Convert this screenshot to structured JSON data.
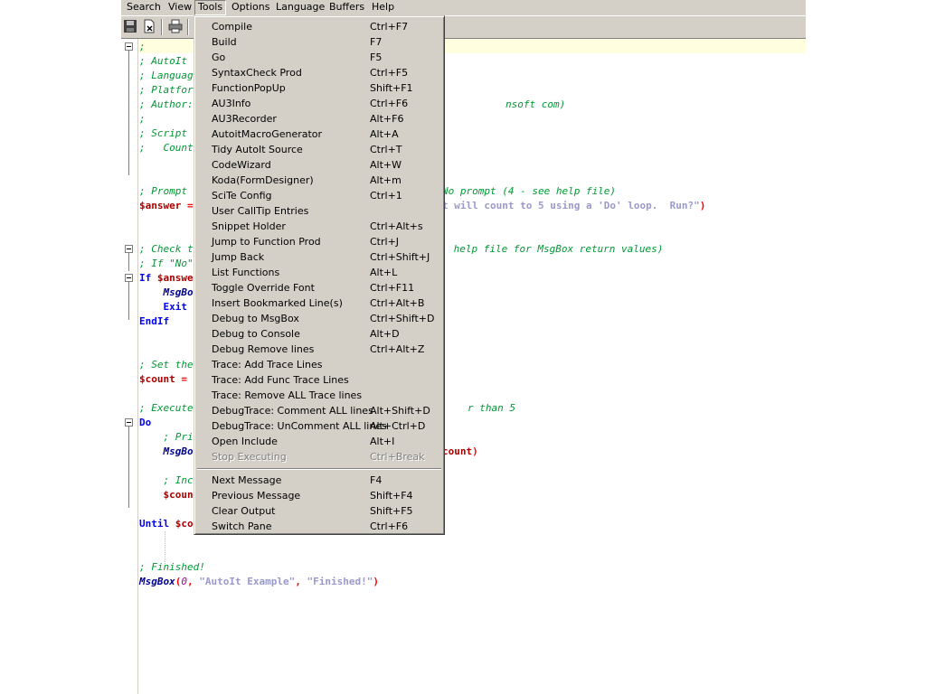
{
  "menubar": {
    "items": [
      "Search",
      "View",
      "Tools",
      "Options",
      "Language",
      "Buffers",
      "Help"
    ],
    "active": "Tools"
  },
  "toolbar": {
    "icons": [
      "save-icon",
      "close-file-icon",
      "print-icon"
    ]
  },
  "code_lines": [
    {
      "row": 0,
      "parts": [
        {
          "c": "cmt",
          "t": ";"
        }
      ]
    },
    {
      "row": 1,
      "parts": [
        {
          "c": "cmt",
          "t": "; AutoIt "
        }
      ]
    },
    {
      "row": 2,
      "parts": [
        {
          "c": "cmt",
          "t": "; Languag"
        }
      ]
    },
    {
      "row": 3,
      "parts": [
        {
          "c": "cmt",
          "t": "; Platfor"
        }
      ]
    },
    {
      "row": 4,
      "parts": [
        {
          "c": "cmt",
          "t": "; Author:"
        }
      ]
    },
    {
      "row": 5,
      "parts": [
        {
          "c": "cmt",
          "t": ";"
        }
      ]
    },
    {
      "row": 6,
      "parts": [
        {
          "c": "cmt",
          "t": "; Script "
        }
      ]
    },
    {
      "row": 7,
      "parts": [
        {
          "c": "cmt",
          "t": ";   Count"
        }
      ]
    },
    {
      "row": 10,
      "parts": [
        {
          "c": "cmt",
          "t": "; Prompt "
        }
      ]
    },
    {
      "row": 11,
      "parts": [
        {
          "c": "var",
          "t": "$answer"
        },
        {
          "c": "op",
          "t": " ="
        }
      ]
    },
    {
      "row": 14,
      "parts": [
        {
          "c": "cmt",
          "t": "; Check t"
        }
      ]
    },
    {
      "row": 15,
      "parts": [
        {
          "c": "cmt",
          "t": "; If \"No\""
        }
      ]
    },
    {
      "row": 16,
      "parts": [
        {
          "c": "kw",
          "t": "If "
        },
        {
          "c": "var",
          "t": "$answe"
        }
      ]
    },
    {
      "row": 17,
      "parts": [
        {
          "c": "",
          "t": "    "
        },
        {
          "c": "fn",
          "t": "MsgBo"
        }
      ]
    },
    {
      "row": 18,
      "parts": [
        {
          "c": "",
          "t": "    "
        },
        {
          "c": "kw",
          "t": "Exit"
        }
      ]
    },
    {
      "row": 19,
      "parts": [
        {
          "c": "kw",
          "t": "EndIf"
        }
      ]
    },
    {
      "row": 22,
      "parts": [
        {
          "c": "cmt",
          "t": "; Set the"
        }
      ]
    },
    {
      "row": 23,
      "parts": [
        {
          "c": "var",
          "t": "$count"
        },
        {
          "c": "op",
          "t": " ="
        }
      ]
    },
    {
      "row": 25,
      "parts": [
        {
          "c": "cmt",
          "t": "; Execute"
        }
      ]
    },
    {
      "row": 26,
      "parts": [
        {
          "c": "kw",
          "t": "Do"
        }
      ]
    },
    {
      "row": 27,
      "parts": [
        {
          "c": "",
          "t": "    "
        },
        {
          "c": "cmt",
          "t": "; Pri"
        }
      ]
    },
    {
      "row": 28,
      "parts": [
        {
          "c": "",
          "t": "    "
        },
        {
          "c": "fn",
          "t": "MsgBo"
        }
      ]
    },
    {
      "row": 30,
      "parts": [
        {
          "c": "",
          "t": "    "
        },
        {
          "c": "cmt",
          "t": "; Inc"
        }
      ]
    },
    {
      "row": 31,
      "parts": [
        {
          "c": "",
          "t": "    "
        },
        {
          "c": "var",
          "t": "$coun"
        }
      ]
    },
    {
      "row": 33,
      "parts": [
        {
          "c": "kw",
          "t": "Until "
        },
        {
          "c": "var",
          "t": "$co"
        }
      ]
    },
    {
      "row": 36,
      "parts": [
        {
          "c": "cmt",
          "t": "; Finished!"
        }
      ]
    },
    {
      "row": 37,
      "parts": [
        {
          "c": "fn",
          "t": "MsgBox"
        },
        {
          "c": "op",
          "t": "("
        },
        {
          "c": "num",
          "t": "0"
        },
        {
          "c": "op",
          "t": ", "
        },
        {
          "c": "str",
          "t": "\"AutoIt Example\""
        },
        {
          "c": "op",
          "t": ", "
        },
        {
          "c": "str",
          "t": "\"Finished!\""
        },
        {
          "c": "op",
          "t": ")"
        }
      ]
    }
  ],
  "code_right_fragments": [
    {
      "row": 4,
      "parts": [
        {
          "c": "cmt",
          "t": "nsoft com)"
        }
      ]
    },
    {
      "row": 10,
      "parts": [
        {
          "c": "cmt",
          "t": "No prompt (4 - see help file)"
        }
      ]
    },
    {
      "row": 11,
      "parts": [
        {
          "c": "str",
          "t": "t will count to 5 using a 'Do' loop.  Run?\""
        },
        {
          "c": "op",
          "t": ")"
        }
      ]
    },
    {
      "row": 14,
      "parts": [
        {
          "c": "cmt",
          "t": " help file for MsgBox return values)"
        }
      ]
    },
    {
      "row": 25,
      "parts": [
        {
          "c": "cmt",
          "t": "r than 5"
        }
      ]
    },
    {
      "row": 28,
      "parts": [
        {
          "c": "var",
          "t": "count"
        },
        {
          "c": "op",
          "t": ")"
        }
      ]
    }
  ],
  "tools_menu": {
    "group1": [
      {
        "label": "Compile",
        "shortcut": "Ctrl+F7"
      },
      {
        "label": "Build",
        "shortcut": "F7"
      },
      {
        "label": "Go",
        "shortcut": "F5"
      },
      {
        "label": "SyntaxCheck Prod",
        "shortcut": "Ctrl+F5"
      },
      {
        "label": "FunctionPopUp",
        "shortcut": "Shift+F1"
      },
      {
        "label": "AU3Info",
        "shortcut": "Ctrl+F6"
      },
      {
        "label": "AU3Recorder",
        "shortcut": "Alt+F6"
      },
      {
        "label": "AutoitMacroGenerator",
        "shortcut": "Alt+A"
      },
      {
        "label": "Tidy AutoIt Source",
        "shortcut": "Ctrl+T"
      },
      {
        "label": "CodeWizard",
        "shortcut": "Alt+W"
      },
      {
        "label": "Koda(FormDesigner)",
        "shortcut": "Alt+m"
      },
      {
        "label": "SciTe Config",
        "shortcut": "Ctrl+1"
      },
      {
        "label": "User CallTip Entries",
        "shortcut": ""
      },
      {
        "label": "Snippet Holder",
        "shortcut": "Ctrl+Alt+s"
      },
      {
        "label": "Jump to Function Prod",
        "shortcut": "Ctrl+J"
      },
      {
        "label": "Jump Back",
        "shortcut": "Ctrl+Shift+J"
      },
      {
        "label": "List Functions",
        "shortcut": "Alt+L"
      },
      {
        "label": "Toggle Override Font",
        "shortcut": "Ctrl+F11"
      },
      {
        "label": "Insert Bookmarked Line(s)",
        "shortcut": "Ctrl+Alt+B"
      },
      {
        "label": "Debug to MsgBox",
        "shortcut": "Ctrl+Shift+D"
      },
      {
        "label": "Debug to Console",
        "shortcut": "Alt+D"
      },
      {
        "label": "Debug Remove lines",
        "shortcut": "Ctrl+Alt+Z"
      },
      {
        "label": "Trace: Add Trace Lines",
        "shortcut": ""
      },
      {
        "label": "Trace: Add Func Trace Lines",
        "shortcut": ""
      },
      {
        "label": "Trace: Remove ALL Trace lines",
        "shortcut": ""
      },
      {
        "label": "DebugTrace: Comment ALL lines",
        "shortcut": "Alt+Shift+D"
      },
      {
        "label": "DebugTrace: UnComment ALL lines",
        "shortcut": "Alt+Ctrl+D"
      },
      {
        "label": "Open Include",
        "shortcut": "Alt+I"
      },
      {
        "label": "Stop Executing",
        "shortcut": "Ctrl+Break",
        "disabled": true
      }
    ],
    "group2": [
      {
        "label": "Next Message",
        "shortcut": "F4"
      },
      {
        "label": "Previous Message",
        "shortcut": "Shift+F4"
      },
      {
        "label": "Clear Output",
        "shortcut": "Shift+F5"
      },
      {
        "label": "Switch Pane",
        "shortcut": "Ctrl+F6"
      }
    ]
  }
}
